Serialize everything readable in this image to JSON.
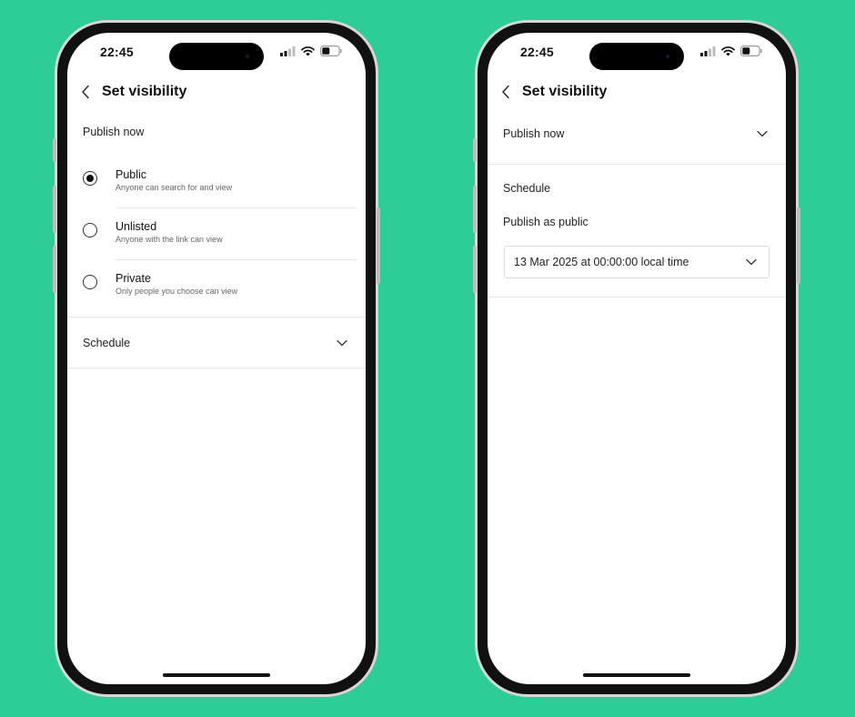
{
  "status_bar": {
    "time": "22:45"
  },
  "left": {
    "title": "Set visibility",
    "publish_now_label": "Publish now",
    "options": [
      {
        "label": "Public",
        "description": "Anyone can search for and view",
        "selected": true
      },
      {
        "label": "Unlisted",
        "description": "Anyone with the link can view",
        "selected": false
      },
      {
        "label": "Private",
        "description": "Only people you choose can view",
        "selected": false
      }
    ],
    "schedule_label": "Schedule"
  },
  "right": {
    "title": "Set visibility",
    "publish_now_label": "Publish now",
    "schedule_label": "Schedule",
    "publish_as_label": "Publish as public",
    "date_value": "13 Mar 2025 at 00:00:00 local time"
  },
  "icons": {
    "back": "chevron-left-icon",
    "expand": "chevron-down-icon",
    "signal": "cellular-signal-icon",
    "wifi": "wifi-icon",
    "battery": "battery-icon"
  },
  "colors": {
    "background": "#2ecc97",
    "screen": "#ffffff",
    "frame": "#111111"
  }
}
